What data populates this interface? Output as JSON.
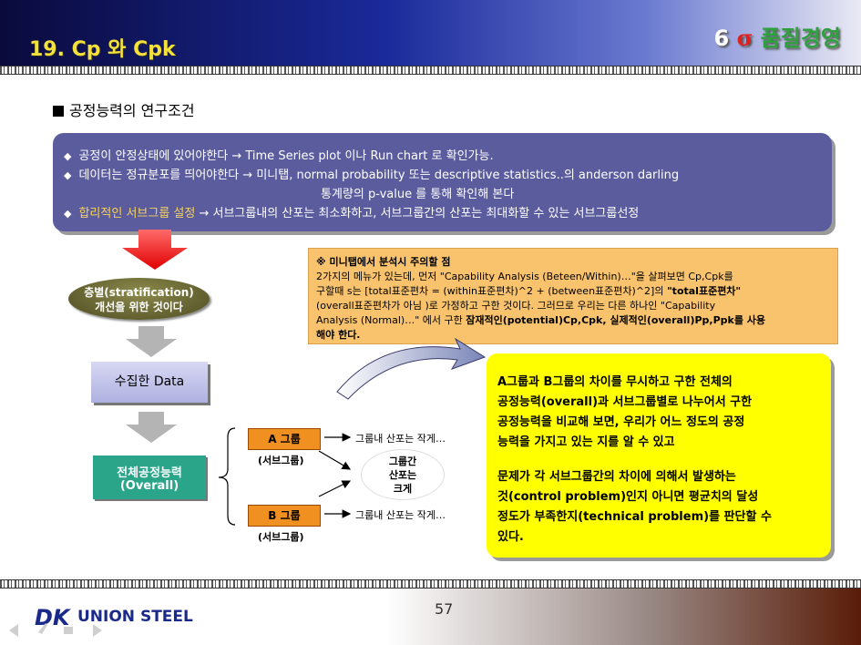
{
  "header": {
    "title": "19. Cp 와 Cpk",
    "brand_six": "6",
    "brand_sigma": "σ",
    "brand_text": "품질경영"
  },
  "heading": "공정능력의 연구조건",
  "conditions": {
    "line1": "공정이 안정상태에 있어야한다 → Time Series plot 이나 Run chart 로 확인가능.",
    "line2": "데이터는 정규분포를 띄어야한다 → 미니탭, normal probability 또는 descriptive statistics..의 anderson darling",
    "line2b": "통계량의 p-value 를 통해 확인해 본다",
    "line3_highlight": "합리적인 서브그룹 설정",
    "line3_rest": " → 서브그룹내의 산포는 최소화하고, 서브그룹간의 산포는 최대화할 수 있는 서브그룹선정"
  },
  "minitab_note": {
    "title": "※ 미니탭에서 분석시 주의할 점",
    "line1": "2가지의 메뉴가 있는데, 먼저 \"Capability Analysis (Beteen/Within)…\"을 살펴보면 Cp,Cpk를",
    "line2a": "구할때 s는 [total표준편차 = (within표준편차)^2 + (between표준편차)^2]의 ",
    "line2b": "\"total표준편차\"",
    "line3": "(overall표준편차가 아님 )로 가정하고 구한 것이다. 그러므로 우리는 다른 하나인 \"Capability",
    "line4a": "Analysis (Normal)…\"  에서 구한 ",
    "line4b": "잠재적인(potential)Cp,Cpk, 실제적인(overall)Pp,Ppk를 사용",
    "line5": "해야 한다."
  },
  "flow": {
    "stratification_line1": "층별(stratification)",
    "stratification_line2": "개선을 위한 것이다",
    "collected_data": "수집한 Data",
    "overall_line1": "전체공정능력",
    "overall_line2": "(Overall)",
    "group_a": "A 그룹",
    "group_a_sub": "(서브그룹)",
    "group_b": "B 그룹",
    "group_b_sub": "(서브그룹)",
    "within_a": "그룹내 산포는 작게…",
    "within_b": "그룹내 산포는 작게…",
    "between_line1": "그룹간",
    "between_line2": "산포는",
    "between_line3": "크게"
  },
  "explanation": {
    "p1_line1": "A그룹과 B그룹의 차이를 무시하고 구한 전체의",
    "p1_line2": "공정능력(overall)과 서브그룹별로 나누어서 구한",
    "p1_line3": "공정능력을 비교해 보면, 우리가 어느 정도의 공정",
    "p1_line4": "능력을 가지고 있는 지를 알 수 있고",
    "p2_line1": "문제가 각 서브그룹간의 차이에 의해서 발생하는",
    "p2_line2": "것(control problem)인지 아니면 평균치의 달성",
    "p2_line3": "정도가 부족한지(technical problem)를  판단할 수",
    "p2_line4": "있다."
  },
  "footer": {
    "page_number": "57",
    "logo_dk": "DK",
    "logo_text": "UNION STEEL"
  }
}
